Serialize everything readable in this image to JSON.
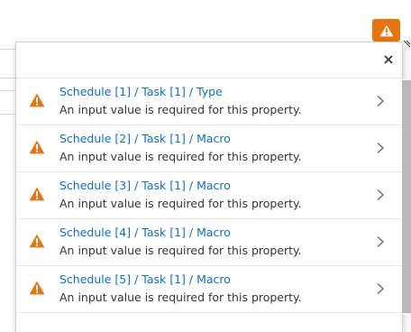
{
  "warning_button": {
    "icon": "warning-triangle-icon",
    "color": "#e9730c"
  },
  "popover": {
    "close_icon": "close-icon",
    "messages": [
      {
        "title": "Schedule [1] / Task [1] / Type",
        "description": "An input value is required for this property."
      },
      {
        "title": "Schedule [2] / Task [1] / Macro",
        "description": "An input value is required for this property."
      },
      {
        "title": "Schedule [3] / Task [1] / Macro",
        "description": "An input value is required for this property."
      },
      {
        "title": "Schedule [4] / Task [1] / Macro",
        "description": "An input value is required for this property."
      },
      {
        "title": "Schedule [5] / Task [1] / Macro",
        "description": "An input value is required for this property."
      }
    ]
  },
  "colors": {
    "link": "#0a6ed1",
    "warning": "#e9730c",
    "text": "#32363a"
  }
}
